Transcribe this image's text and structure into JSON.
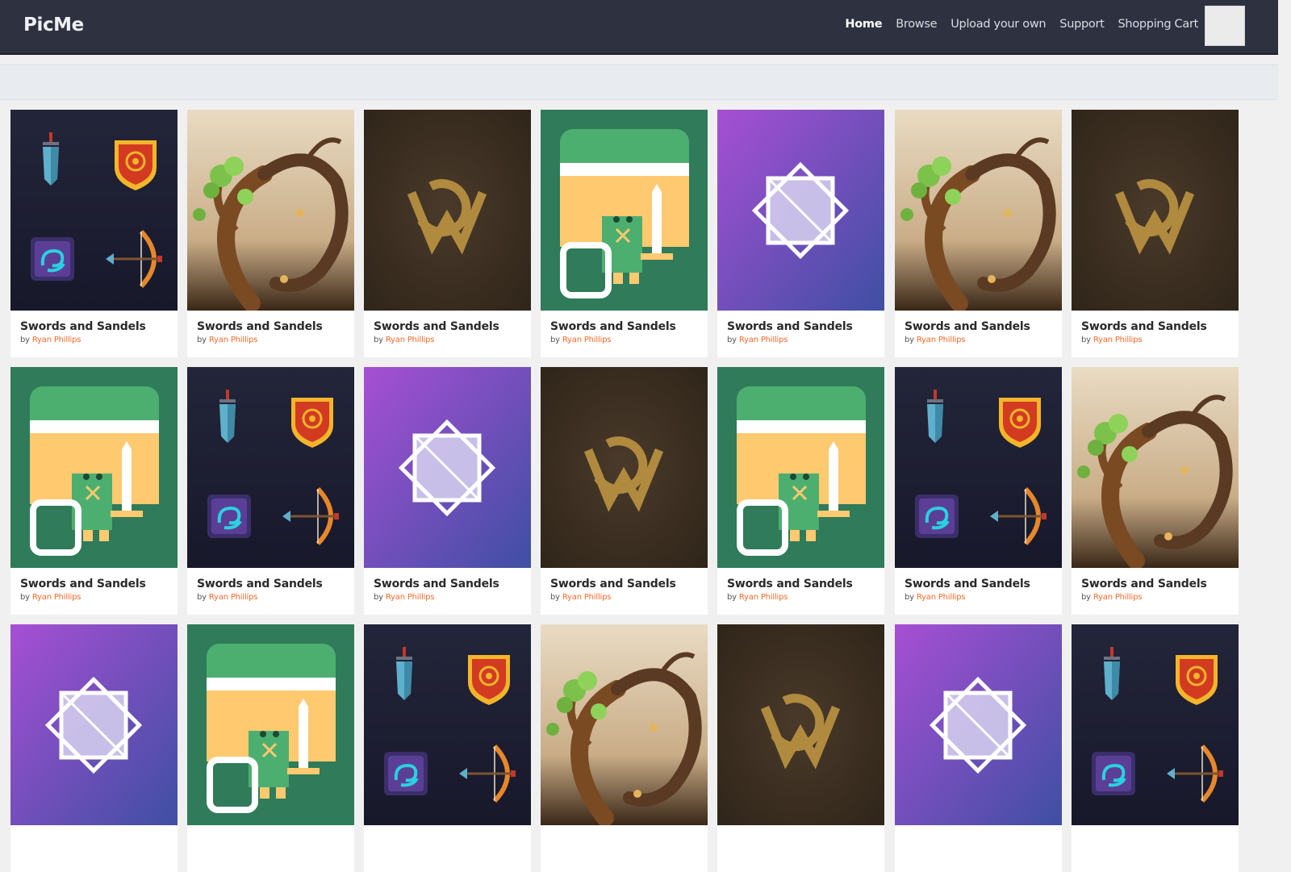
{
  "brand": "PicMe",
  "nav": [
    {
      "label": "Home",
      "active": true
    },
    {
      "label": "Browse",
      "active": false
    },
    {
      "label": "Upload your own",
      "active": false
    },
    {
      "label": "Support",
      "active": false
    },
    {
      "label": "Shopping Cart",
      "active": false
    }
  ],
  "by_prefix": "by",
  "accent_color": "#f06a2a",
  "cards": [
    {
      "title": "Swords and Sandels",
      "author": "Ryan Phillips",
      "image": "game-icons"
    },
    {
      "title": "Swords and Sandels",
      "author": "Ryan Phillips",
      "image": "tree"
    },
    {
      "title": "Swords and Sandels",
      "author": "Ryan Phillips",
      "image": "gold-logo"
    },
    {
      "title": "Swords and Sandels",
      "author": "Ryan Phillips",
      "image": "knight"
    },
    {
      "title": "Swords and Sandels",
      "author": "Ryan Phillips",
      "image": "star-gradient"
    },
    {
      "title": "Swords and Sandels",
      "author": "Ryan Phillips",
      "image": "tree"
    },
    {
      "title": "Swords and Sandels",
      "author": "Ryan Phillips",
      "image": "gold-logo"
    },
    {
      "title": "Swords and Sandels",
      "author": "Ryan Phillips",
      "image": "knight"
    },
    {
      "title": "Swords and Sandels",
      "author": "Ryan Phillips",
      "image": "game-icons"
    },
    {
      "title": "Swords and Sandels",
      "author": "Ryan Phillips",
      "image": "star-gradient"
    },
    {
      "title": "Swords and Sandels",
      "author": "Ryan Phillips",
      "image": "gold-logo"
    },
    {
      "title": "Swords and Sandels",
      "author": "Ryan Phillips",
      "image": "knight"
    },
    {
      "title": "Swords and Sandels",
      "author": "Ryan Phillips",
      "image": "game-icons"
    },
    {
      "title": "Swords and Sandels",
      "author": "Ryan Phillips",
      "image": "tree"
    },
    {
      "title": "",
      "author": "",
      "image": "star-gradient"
    },
    {
      "title": "",
      "author": "",
      "image": "knight"
    },
    {
      "title": "",
      "author": "",
      "image": "game-icons"
    },
    {
      "title": "",
      "author": "",
      "image": "tree"
    },
    {
      "title": "",
      "author": "",
      "image": "gold-logo"
    },
    {
      "title": "",
      "author": "",
      "image": "star-gradient"
    },
    {
      "title": "",
      "author": "",
      "image": "game-icons"
    }
  ]
}
